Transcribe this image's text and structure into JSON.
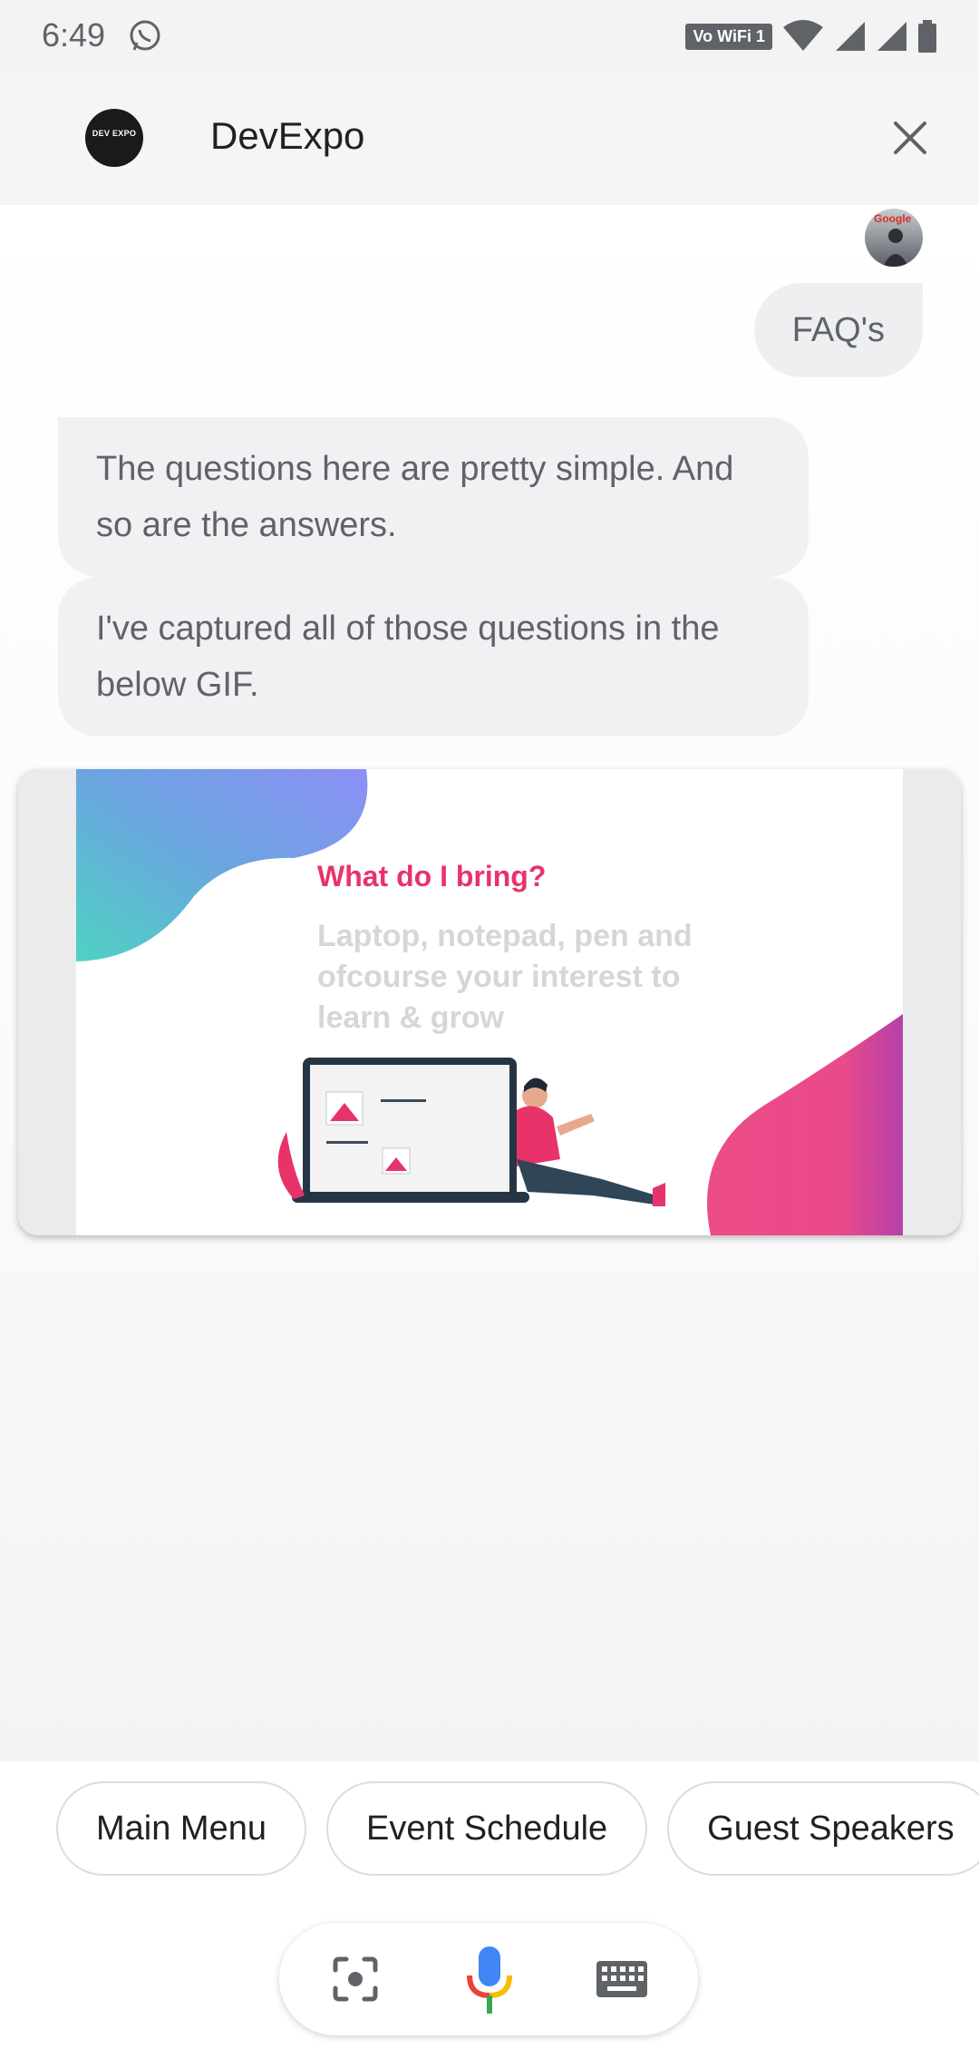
{
  "status_bar": {
    "time": "6:49",
    "network_badge": "Vo WiFi 1",
    "icons": [
      "whatsapp-icon",
      "wifi-icon",
      "signal-icon",
      "signal-roaming-icon",
      "battery-icon"
    ]
  },
  "header": {
    "logo_text": "DEV EXPO",
    "title": "DevExpo",
    "close_icon": "close-icon"
  },
  "conversation": {
    "user_avatar_label": "Google",
    "user_message": "FAQ's",
    "bot_messages": [
      "The questions here are pretty simple. And so are the answers.",
      "I've captured all of those questions in the below GIF."
    ],
    "gif": {
      "heading": "What do I bring?",
      "body": "Laptop, notepad, pen and ofcourse your interest to learn & grow"
    }
  },
  "suggestion_chips": [
    "Main Menu",
    "Event Schedule",
    "Guest Speakers"
  ],
  "input_bar": {
    "icons": [
      "lens-icon",
      "mic-icon",
      "keyboard-icon"
    ]
  },
  "colors": {
    "accent_pink": "#e8336a",
    "mic_blue": "#4285f4",
    "mic_red": "#ea4335",
    "mic_yellow": "#fbbc04",
    "mic_green": "#34a853"
  }
}
